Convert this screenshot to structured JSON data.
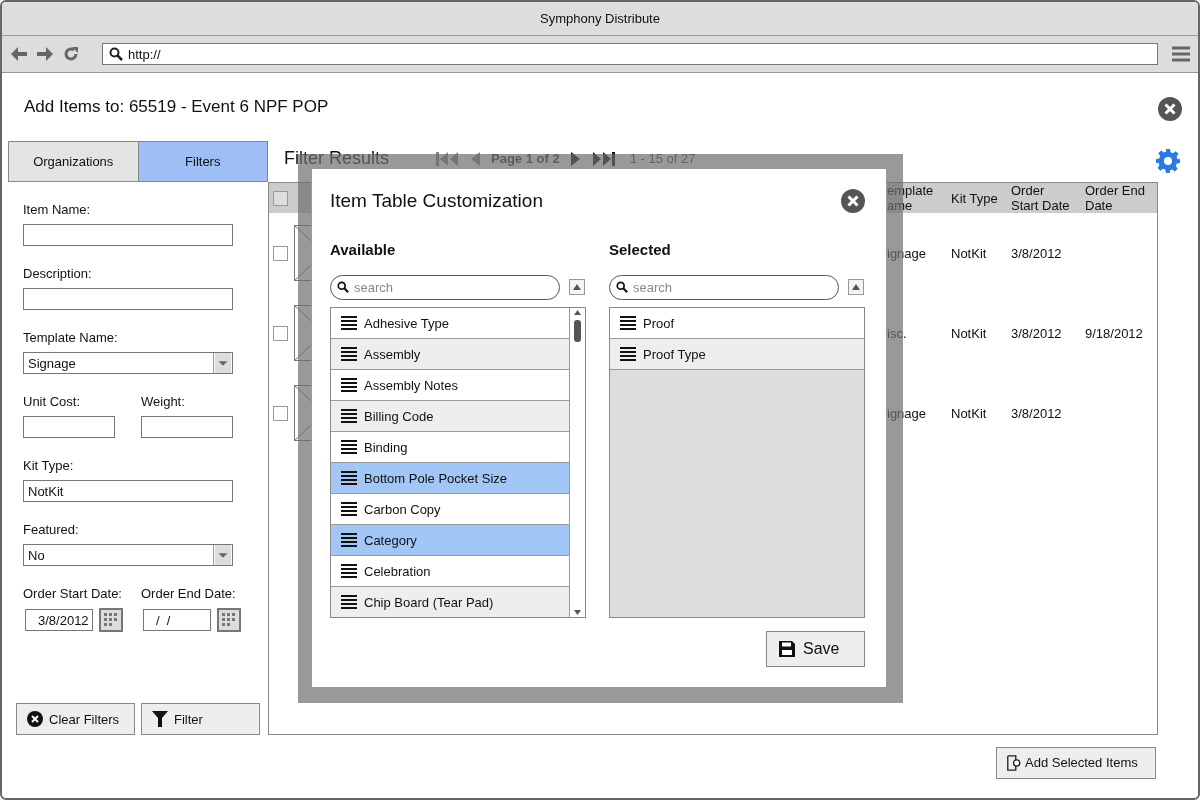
{
  "window": {
    "title": "Symphony Distribute"
  },
  "address_bar": {
    "value": "http://"
  },
  "page_title": "Add Items to: 65519 - Event 6 NPF POP",
  "tabs": [
    {
      "label": "Organizations",
      "selected": false
    },
    {
      "label": "Filters",
      "selected": true
    }
  ],
  "filter_rows": [
    {
      "fields": [
        {
          "kind": "text",
          "label": "Item Name:"
        }
      ]
    },
    {
      "fields": [
        {
          "kind": "text",
          "label": "Description:"
        }
      ]
    },
    {
      "fields": [
        {
          "kind": "select",
          "label": "Template Name:",
          "value": "Signage"
        }
      ]
    },
    {
      "fields": [
        {
          "kind": "text",
          "label": "Unit Cost:"
        },
        {
          "kind": "text",
          "label": "Weight:"
        }
      ]
    },
    {
      "fields": [
        {
          "kind": "text",
          "label": "Kit Type:",
          "value": "NotKit"
        }
      ]
    },
    {
      "fields": [
        {
          "kind": "select",
          "label": "Featured:",
          "value": "No"
        }
      ]
    },
    {
      "fields": [
        {
          "kind": "date",
          "label": "Order Start Date:",
          "value": "3/8/2012"
        },
        {
          "kind": "date",
          "label": "Order End Date:",
          "value": "/  /"
        }
      ]
    }
  ],
  "filter_buttons": [
    {
      "kind": "clear",
      "label": "Clear Filters"
    },
    {
      "kind": "filter",
      "label": "Filter"
    }
  ],
  "results": {
    "title": "Filter Results",
    "pager": {
      "page": "Page 1 of 2",
      "range": "1 - 15 of 27"
    },
    "table": {
      "header_checked": false,
      "columns": [
        "emplate ame",
        "Kit Type",
        "Order Start Date",
        "Order End Date"
      ],
      "rows": [
        {
          "checked": false,
          "cells": [
            "ignage",
            "NotKit",
            "3/8/2012"
          ]
        },
        {
          "checked": false,
          "cells": [
            "isc.",
            "NotKit",
            "3/8/2012",
            "9/18/2012"
          ]
        },
        {
          "checked": false,
          "cells": [
            "ignage",
            "NotKit",
            "3/8/2012"
          ]
        }
      ]
    }
  },
  "add_button": "Add Selected Items",
  "modal": {
    "title": "Item Table Customization",
    "available": {
      "heading": "Available",
      "placeholder": "search",
      "items": [
        {
          "label": "Adhesive Type",
          "selected": false
        },
        {
          "label": "Assembly",
          "selected": false
        },
        {
          "label": "Assembly Notes",
          "selected": false
        },
        {
          "label": "Billing Code",
          "selected": false
        },
        {
          "label": "Binding",
          "selected": false
        },
        {
          "label": "Bottom Pole Pocket Size",
          "selected": true
        },
        {
          "label": "Carbon Copy",
          "selected": false
        },
        {
          "label": "Category",
          "selected": true
        },
        {
          "label": "Celebration",
          "selected": false
        },
        {
          "label": "Chip Board (Tear Pad)",
          "selected": false
        }
      ]
    },
    "selected": {
      "heading": "Selected",
      "placeholder": "search",
      "items": [
        {
          "label": "Proof",
          "selected": false
        },
        {
          "label": "Proof Type",
          "selected": false
        }
      ]
    },
    "save": "Save"
  }
}
